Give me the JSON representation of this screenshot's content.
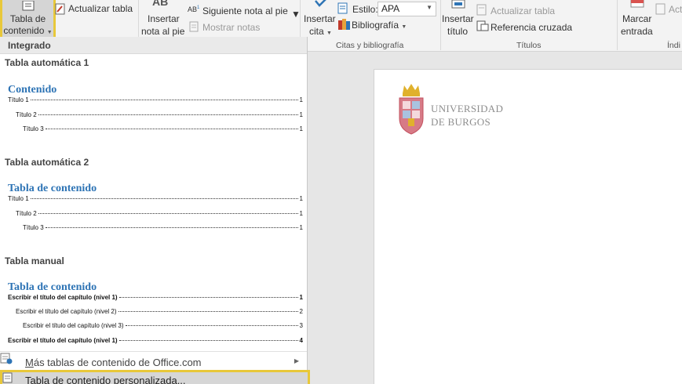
{
  "ribbon": {
    "toc_button": {
      "line1": "Tabla de",
      "line2": "contenido"
    },
    "update_table": "Actualizar tabla",
    "ab_icon_text": "AB",
    "insert_footnote": {
      "line1": "Insertar",
      "line2": "nota al pie"
    },
    "next_footnote": "Siguiente nota al pie",
    "show_notes": "Mostrar notas",
    "insert_citation": {
      "line1": "Insertar",
      "line2": "cita"
    },
    "style_label": "Estilo:",
    "style_value": "APA",
    "bibliography": "Bibliografía",
    "citations_group": "Citas y bibliografía",
    "insert_caption": {
      "line1": "Insertar",
      "line2": "título"
    },
    "update_table_2": "Actualizar tabla",
    "cross_reference": "Referencia cruzada",
    "captions_group": "Títulos",
    "mark_entry": {
      "line1": "Marcar",
      "line2": "entrada"
    },
    "act_partial": "Act",
    "index_group_partial": "Índi"
  },
  "gallery": {
    "header": "Integrado",
    "sections": [
      {
        "title": "Tabla automática 1",
        "heading": "Contenido",
        "lines": [
          {
            "text": "Título 1",
            "page": "1"
          },
          {
            "text": "Título 2",
            "page": "1"
          },
          {
            "text": "Título 3",
            "page": "1"
          }
        ]
      },
      {
        "title": "Tabla automática 2",
        "heading": "Tabla de contenido",
        "lines": [
          {
            "text": "Título 1",
            "page": "1"
          },
          {
            "text": "Título 2",
            "page": "1"
          },
          {
            "text": "Título 3",
            "page": "1"
          }
        ]
      },
      {
        "title": "Tabla manual",
        "heading": "Tabla de contenido",
        "lines": [
          {
            "text": "Escribir el título del capítulo (nivel 1)",
            "page": "1"
          },
          {
            "text": "Escribir el título del capítulo (nivel 2)",
            "page": "2"
          },
          {
            "text": "Escribir el título del capítulo (nivel 3)",
            "page": "3"
          },
          {
            "text": "Escribir el título del capítulo (nivel 1)",
            "page": "4"
          }
        ]
      }
    ],
    "more_tables": {
      "prefix": "M",
      "rest": "ás tablas de contenido de Office.com"
    },
    "custom_toc": "Tabla de contenido personalizada..."
  },
  "document": {
    "logo_line1": "UNIVERSIDAD",
    "logo_line2": "DE BURGOS"
  },
  "colors": {
    "highlight": "#e8c83a",
    "heading_blue": "#2e74b5"
  }
}
